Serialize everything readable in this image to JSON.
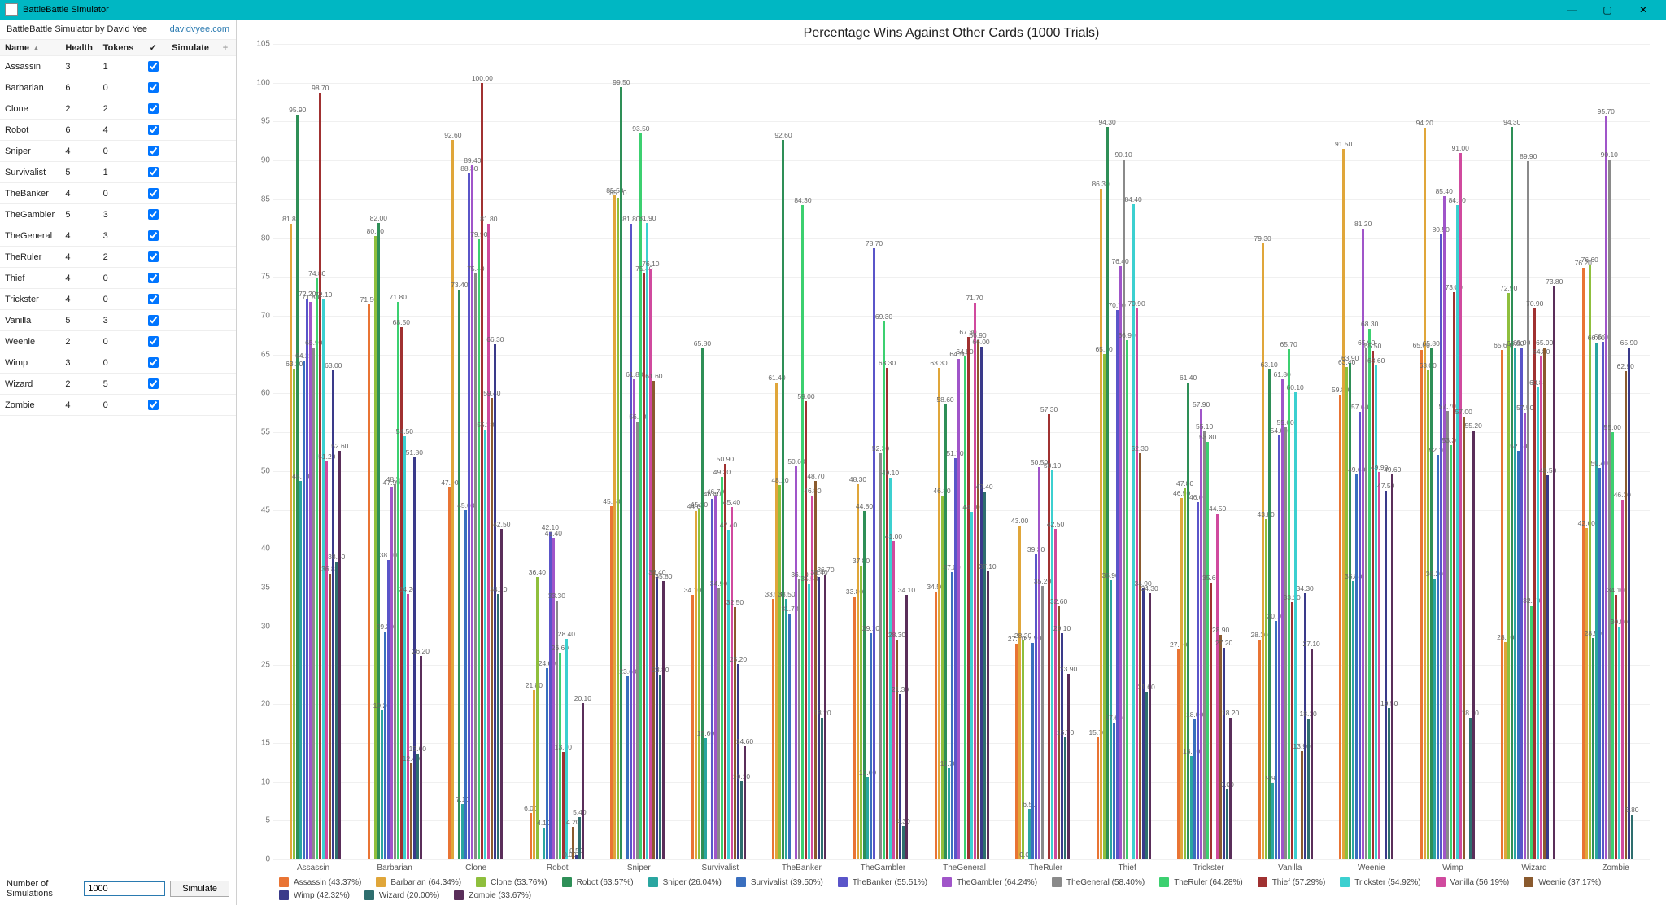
{
  "window": {
    "title": "BattleBattle Simulator",
    "subtitle": "BattleBattle Simulator by David Yee",
    "link_text": "davidvyee.com"
  },
  "table": {
    "headers": {
      "name": "Name",
      "health": "Health",
      "tokens": "Tokens",
      "simulate": "Simulate"
    },
    "rows": [
      {
        "name": "Assassin",
        "health": 3,
        "tokens": 1,
        "simulate": true
      },
      {
        "name": "Barbarian",
        "health": 6,
        "tokens": 0,
        "simulate": true
      },
      {
        "name": "Clone",
        "health": 2,
        "tokens": 2,
        "simulate": true
      },
      {
        "name": "Robot",
        "health": 6,
        "tokens": 4,
        "simulate": true
      },
      {
        "name": "Sniper",
        "health": 4,
        "tokens": 0,
        "simulate": true
      },
      {
        "name": "Survivalist",
        "health": 5,
        "tokens": 1,
        "simulate": true
      },
      {
        "name": "TheBanker",
        "health": 4,
        "tokens": 0,
        "simulate": true
      },
      {
        "name": "TheGambler",
        "health": 5,
        "tokens": 3,
        "simulate": true
      },
      {
        "name": "TheGeneral",
        "health": 4,
        "tokens": 3,
        "simulate": true
      },
      {
        "name": "TheRuler",
        "health": 4,
        "tokens": 2,
        "simulate": true
      },
      {
        "name": "Thief",
        "health": 4,
        "tokens": 0,
        "simulate": true
      },
      {
        "name": "Trickster",
        "health": 4,
        "tokens": 0,
        "simulate": true
      },
      {
        "name": "Vanilla",
        "health": 5,
        "tokens": 3,
        "simulate": true
      },
      {
        "name": "Weenie",
        "health": 2,
        "tokens": 0,
        "simulate": true
      },
      {
        "name": "Wimp",
        "health": 3,
        "tokens": 0,
        "simulate": true
      },
      {
        "name": "Wizard",
        "health": 2,
        "tokens": 5,
        "simulate": true
      },
      {
        "name": "Zombie",
        "health": 4,
        "tokens": 0,
        "simulate": true
      }
    ]
  },
  "footer": {
    "label": "Number of Simulations",
    "value": "1000",
    "button": "Simulate"
  },
  "chart_data": {
    "type": "bar",
    "title": "Percentage Wins Against Other Cards (1000 Trials)",
    "ylabel": "",
    "xlabel": "",
    "ylim": [
      0,
      105
    ],
    "yticks": [
      0,
      5,
      10,
      15,
      20,
      25,
      30,
      35,
      40,
      45,
      50,
      55,
      60,
      65,
      70,
      75,
      80,
      85,
      90,
      95,
      100,
      105
    ],
    "categories": [
      "Assassin",
      "Barbarian",
      "Clone",
      "Robot",
      "Sniper",
      "Survivalist",
      "TheBanker",
      "TheGambler",
      "TheGeneral",
      "TheRuler",
      "Thief",
      "Trickster",
      "Vanilla",
      "Weenie",
      "Wimp",
      "Wizard",
      "Zombie"
    ],
    "colors": {
      "Assassin": "#e97434",
      "Barbarian": "#e0a63a",
      "Clone": "#8fbf3d",
      "Robot": "#2e8f57",
      "Sniper": "#2aa6a0",
      "Survivalist": "#3a6fbf",
      "TheBanker": "#5a55c9",
      "TheGambler": "#a055c9",
      "TheGeneral": "#8a8a8a",
      "TheRuler": "#3cd070",
      "Thief": "#a03131",
      "Trickster": "#3cd0d0",
      "Vanilla": "#d04a9e",
      "Weenie": "#8a5a2e",
      "Wimp": "#3a3a8a",
      "Wizard": "#2e6e6e",
      "Zombie": "#5a2e5a"
    },
    "series": [
      {
        "name": "Assassin",
        "avg": 43.37,
        "values": [
          null,
          71.5,
          47.9,
          6.0,
          45.5,
          34.1,
          33.5,
          33.8,
          34.5,
          27.8,
          15.7,
          27.0,
          28.3,
          59.8,
          65.6,
          65.6,
          76.2
        ]
      },
      {
        "name": "Barbarian",
        "avg": 64.34,
        "values": [
          81.8,
          null,
          92.6,
          21.8,
          85.5,
          44.8,
          61.4,
          48.3,
          63.3,
          43.0,
          86.3,
          46.5,
          79.3,
          91.5,
          94.2,
          28.0,
          42.6
        ]
      },
      {
        "name": "Clone",
        "avg": 53.76,
        "values": [
          63.2,
          80.3,
          null,
          36.4,
          85.2,
          45.1,
          48.2,
          37.8,
          46.8,
          28.2,
          65.1,
          47.8,
          43.8,
          63.4,
          63.0,
          72.9,
          76.6
        ]
      },
      {
        "name": "Robot",
        "avg": 63.57,
        "values": [
          95.9,
          82.0,
          73.4,
          null,
          99.5,
          65.8,
          92.6,
          44.8,
          58.6,
          0.0,
          94.3,
          61.4,
          63.1,
          63.9,
          65.8,
          94.3,
          28.5
        ]
      },
      {
        "name": "Sniper",
        "avg": 26.04,
        "values": [
          48.7,
          19.2,
          7.1,
          4.1,
          null,
          15.6,
          33.5,
          10.6,
          11.7,
          6.5,
          35.9,
          13.3,
          9.9,
          35.8,
          36.2,
          65.8,
          66.5
        ]
      },
      {
        "name": "Survivalist",
        "avg": 39.5,
        "values": [
          64.2,
          29.3,
          45.0,
          24.6,
          23.6,
          null,
          31.7,
          29.1,
          37.0,
          27.9,
          17.6,
          18.0,
          30.7,
          49.6,
          52.1,
          52.6,
          50.4
        ]
      },
      {
        "name": "TheBanker",
        "avg": 55.51,
        "values": [
          72.2,
          38.6,
          88.3,
          42.1,
          81.8,
          46.4,
          null,
          78.7,
          51.7,
          39.3,
          70.7,
          46.0,
          54.6,
          57.6,
          80.5,
          65.9,
          66.7
        ]
      },
      {
        "name": "TheGambler",
        "avg": 64.24,
        "values": [
          71.8,
          47.9,
          89.4,
          41.4,
          61.8,
          46.7,
          50.6,
          null,
          64.5,
          50.5,
          76.4,
          57.9,
          61.8,
          81.2,
          85.4,
          57.5,
          95.7
        ]
      },
      {
        "name": "TheGeneral",
        "avg": 58.4,
        "values": [
          65.9,
          48.3,
          75.4,
          33.3,
          56.4,
          34.9,
          36.1,
          52.3,
          null,
          35.2,
          90.1,
          55.1,
          55.6,
          65.9,
          57.7,
          89.9,
          90.1
        ]
      },
      {
        "name": "TheRuler",
        "avg": 64.28,
        "values": [
          74.8,
          71.8,
          79.9,
          26.6,
          93.5,
          49.3,
          84.3,
          69.3,
          64.8,
          null,
          66.9,
          53.8,
          65.7,
          68.3,
          53.3,
          32.7,
          55.0
        ]
      },
      {
        "name": "Thief",
        "avg": 57.29,
        "values": [
          98.7,
          68.5,
          100.0,
          13.8,
          75.4,
          50.9,
          59.0,
          63.3,
          67.3,
          57.3,
          null,
          35.6,
          33.1,
          65.5,
          73.0,
          70.9,
          34.1
        ]
      },
      {
        "name": "Trickster",
        "avg": 54.92,
        "values": [
          72.1,
          54.5,
          55.3,
          28.4,
          81.9,
          42.4,
          35.5,
          49.1,
          44.7,
          50.1,
          84.4,
          null,
          60.1,
          63.6,
          84.3,
          60.8,
          30.0
        ]
      },
      {
        "name": "Vanilla",
        "avg": 56.19,
        "values": [
          51.2,
          34.2,
          81.8,
          0.0,
          76.1,
          45.4,
          46.8,
          41.0,
          71.7,
          42.5,
          70.9,
          44.5,
          null,
          49.9,
          91.0,
          64.8,
          46.3
        ]
      },
      {
        "name": "Weenie",
        "avg": 37.17,
        "values": [
          36.8,
          12.4,
          59.4,
          4.2,
          61.6,
          32.5,
          48.7,
          28.3,
          66.9,
          32.6,
          52.3,
          28.9,
          13.9,
          null,
          57.0,
          65.9,
          62.9
        ]
      },
      {
        "name": "Wimp",
        "avg": 42.32,
        "values": [
          63.0,
          51.8,
          66.3,
          0.5,
          36.4,
          25.2,
          36.4,
          21.3,
          66.0,
          29.1,
          34.9,
          27.2,
          34.3,
          47.5,
          null,
          49.5,
          65.9
        ]
      },
      {
        "name": "Wizard",
        "avg": 20.0,
        "values": [
          38.4,
          13.6,
          34.2,
          5.4,
          23.8,
          10.1,
          18.2,
          4.3,
          47.4,
          15.7,
          21.6,
          9.0,
          18.1,
          19.5,
          18.2,
          null,
          5.8
        ]
      },
      {
        "name": "Zombie",
        "avg": 33.67,
        "values": [
          52.6,
          26.2,
          42.5,
          20.1,
          35.8,
          14.6,
          36.7,
          34.1,
          37.1,
          23.9,
          34.3,
          18.2,
          27.1,
          49.6,
          55.2,
          73.8,
          null
        ]
      }
    ]
  }
}
